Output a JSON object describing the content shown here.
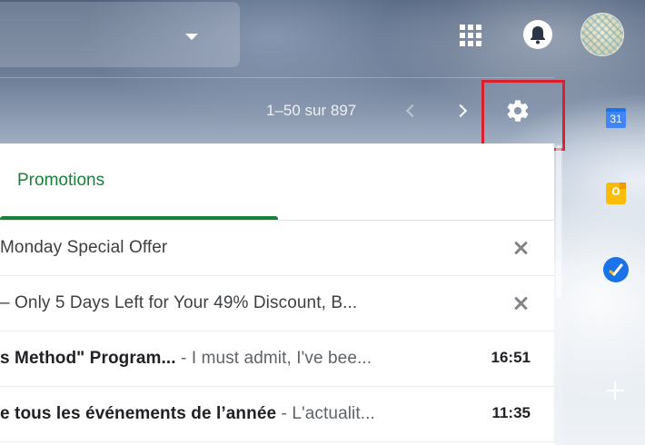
{
  "header": {
    "search_dropdown_icon": "caret-down-icon",
    "apps_icon": "apps-grid-icon",
    "notifications_icon": "bell-icon",
    "avatar_icon": "account-avatar"
  },
  "toolbar": {
    "pagination": "1–50 sur 897",
    "prev_icon": "chevron-left-icon",
    "next_icon": "chevron-right-icon",
    "settings_icon": "gear-icon",
    "highlight_color": "#d9202c"
  },
  "tabs": [
    {
      "label": "Promotions",
      "active": true,
      "color": "#188038"
    }
  ],
  "emails": [
    {
      "sender": "",
      "subject": "Monday Special Offer",
      "snippet": "",
      "time": "",
      "unread": false,
      "action_icon": "close-icon"
    },
    {
      "sender": "",
      "subject": "– Only 5 Days Left for Your 49% Discount, B...",
      "snippet": "",
      "time": "",
      "unread": false,
      "action_icon": "close-icon"
    },
    {
      "sender": "",
      "subject": "s Method\" Program...",
      "snippet": " - I must admit, I've bee...",
      "time": "16:51",
      "unread": true
    },
    {
      "sender": "",
      "subject": "e tous les événements de l’année",
      "snippet": " - L'actualit...",
      "time": "11:35",
      "unread": true
    }
  ],
  "side_panel": {
    "calendar_day": "31",
    "icons": [
      "calendar-icon",
      "keep-icon",
      "tasks-icon",
      "add-icon"
    ]
  }
}
